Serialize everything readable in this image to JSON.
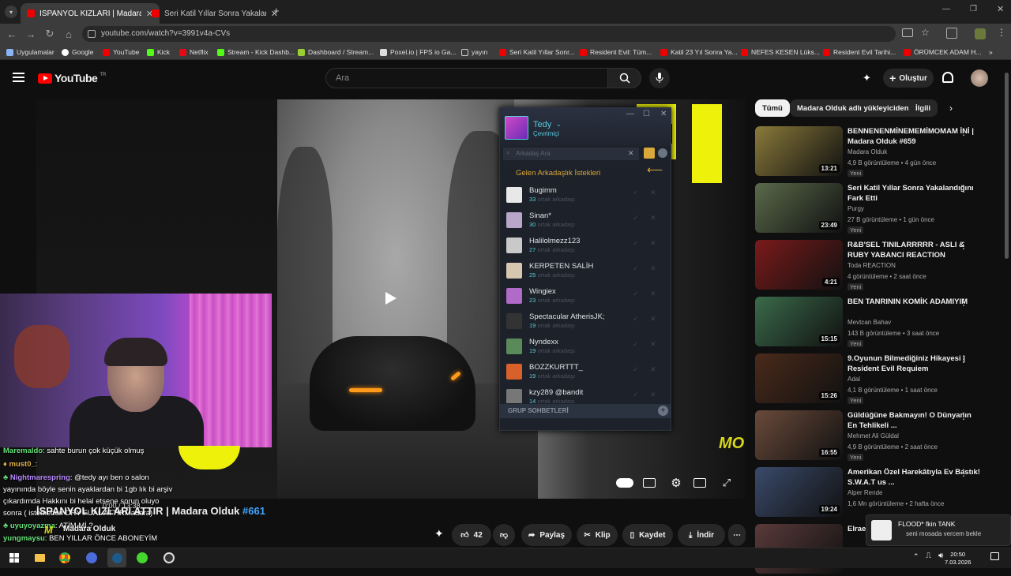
{
  "browser": {
    "tabs": [
      {
        "label": "İSPANYOL KIZLARI | Madara Olduk"
      },
      {
        "label": "Seri Katil Yıllar Sonra Yakalandığı"
      }
    ],
    "url": "youtube.com/watch?v=3991v4a-CVs",
    "bookmarks": [
      "Uygulamalar",
      "Google",
      "YouTube",
      "Kick",
      "Netflix",
      "Stream - Kick Dashb...",
      "Dashboard / Stream...",
      "Poxel.io | FPS io Ga...",
      "yayın",
      "Seri Katil Yıllar Sonr...",
      "Resident Evil: Tüm...",
      "Katil 23 Yıl Sonra Ya...",
      "NEFES KESEN Lüks...",
      "Resident Evil Tarihi...",
      "ÖRÜMCEK ADAM H..."
    ]
  },
  "youtube": {
    "logo": "YouTube",
    "logo_sup": "TR",
    "search_placeholder": "Ara",
    "create_label": "Oluştur"
  },
  "friends": {
    "name": "Tedy",
    "status": "Çevrimiçi",
    "search_placeholder": "Arkadaş Ara",
    "requests_header": "Gelen Arkadaşlık İstekleri",
    "group_label": "GRUP SOHBETLERİ",
    "requests": [
      {
        "name": "Bugimm",
        "count": "33",
        "sub": "ortak arkadaşı",
        "color": "#e8e8e8"
      },
      {
        "name": "Sinan*",
        "count": "30",
        "sub": "ortak arkadaşı",
        "color": "#b9a7c9"
      },
      {
        "name": "Halilolmezz123",
        "count": "27",
        "sub": "ortak arkadaşı",
        "color": "#c9c9c9"
      },
      {
        "name": "KERPETEN SALİH",
        "count": "25",
        "sub": "ortak arkadaşı",
        "color": "#d8c7b0"
      },
      {
        "name": "Wingiex",
        "count": "23",
        "sub": "ortak arkadaşı",
        "color": "#b06ac8"
      },
      {
        "name": "Spectacular AtherisJK;",
        "count": "19",
        "sub": "ortak arkadaşı",
        "color": "#333"
      },
      {
        "name": "Nyndexx",
        "count": "19",
        "sub": "ortak arkadaşı",
        "color": "#5a8a5a"
      },
      {
        "name": "BOZZKURTTT_",
        "count": "19",
        "sub": "ortak arkadaşı",
        "color": "#d8602a"
      },
      {
        "name": "kzy289 @bandit",
        "count": "14",
        "sub": "ortak arkadaşı",
        "color": "#777"
      }
    ]
  },
  "chat": [
    {
      "user": "Maremaldo",
      "color": "#66e07a",
      "msg": ": sahte burun çok küçük olmuş"
    },
    {
      "user": "must0_",
      "color": "#e0b04a",
      "msg": ":"
    },
    {
      "user": "Nightmarespring",
      "color": "#b98aff",
      "msg": ": @tedy ayı ben o salon"
    },
    {
      "user": "",
      "color": "#fff",
      "msg": "yayınında böyle senin ayaklardan bi 1gb lık bi arşiv"
    },
    {
      "user": "",
      "color": "#fff",
      "msg": "çıkardımda Hakkını bi helal etsene sorun oluyo"
    },
    {
      "user": "",
      "color": "#fff",
      "msg": "sonra ( istemeden DRY FUAL ATTIRMadara)"
    },
    {
      "user": "uyuyoyazma",
      "color": "#66e07a",
      "msg": ": ATİM Mİ ?"
    },
    {
      "user": "yungmaysu",
      "color": "#66e07a",
      "msg": ": BEN YILLAR ÖNCE ABONEYİM"
    }
  ],
  "player": {
    "time": "0:00 / 13:38",
    "channel_overlay": "Madara Olduk",
    "watermark": "MO"
  },
  "video": {
    "title": "İSPANYOL KIZLARI ATTIR | Madara Olduk",
    "title_tag": "#661",
    "likes": "42",
    "share": "Paylaş",
    "clip": "Klip",
    "save": "Kaydet",
    "download": "İndir"
  },
  "chips": [
    "Tümü",
    "Madara Olduk adlı yükleyiciden",
    "İlgili"
  ],
  "recommendations": [
    {
      "title": "BENNENENMİNEMEMİMOMAM İNİ | Madara Olduk #659",
      "channel": "Madara Olduk",
      "meta": "4,9 B görüntüleme • 4 gün önce",
      "badge": "Yeni",
      "duration": "13:21",
      "thumb": "#8a7a3a"
    },
    {
      "title": "Seri Katil Yıllar Sonra Yakalandığını Fark Etti",
      "channel": "Purgy",
      "meta": "27 B görüntüleme • 1 gün önce",
      "badge": "Yeni",
      "duration": "23:49",
      "thumb": "#5a6a4a"
    },
    {
      "title": "R&B'SEL TINILARRRRR - ASLI & RUBY  YABANCI REACTION",
      "channel": "Toda REACTION",
      "meta": "4 görüntüleme • 2 saat önce",
      "badge": "Yeni",
      "duration": "4:21",
      "thumb": "#7a1a1a"
    },
    {
      "title": "BEN TANRININ KOMİK ADAMIYIM",
      "channel": "Mevtcan Bahav",
      "meta": "143 B görüntüleme • 3 saat önce",
      "badge": "Yeni",
      "duration": "15:15",
      "thumb": "#3a6a4a"
    },
    {
      "title": "9.Oyunun Bilmediğiniz Hikayesi | Resident Evil Requiem",
      "channel": "Adal",
      "meta": "4,1 B görüntüleme • 1 saat önce",
      "badge": "Yeni",
      "duration": "15:26",
      "thumb": "#4a2a1a"
    },
    {
      "title": "Güldüğüne Bakmayın! O Dünyanın En Tehlikeli ...",
      "channel": "Mehmet Ali Güldal",
      "meta": "4,9 B görüntüleme • 2 saat önce",
      "badge": "Yeni",
      "duration": "16:55",
      "thumb": "#6a4a3a"
    },
    {
      "title": "Amerikan Özel Harekâtıyla Ev Bastık! S.W.A.T us ...",
      "channel": "Alper Rende",
      "meta": "1,6 Mn görüntüleme • 2 hafta önce",
      "badge": "",
      "duration": "19:24",
      "thumb": "#3a4a6a"
    },
    {
      "title": "Elraen said",
      "channel": "",
      "meta": "",
      "badge": "",
      "duration": "",
      "thumb": "#5a3a3a"
    }
  ],
  "notification": {
    "title": "FLOOD* fkin TANK",
    "text": "seni mosada vercem bekle"
  },
  "clock": {
    "time": "20:50",
    "date": "7.03.2026"
  }
}
